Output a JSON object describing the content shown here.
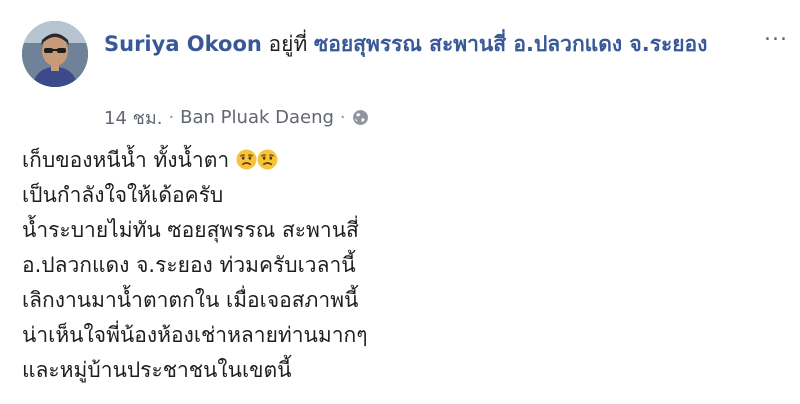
{
  "post": {
    "author": "Suriya Okoon",
    "location_prefix": " อยู่ที่ ",
    "location": "ซอยสุพรรณ สะพานสี่ อ.ปลวกแดง จ.ระยอง",
    "time": "14 ชม.",
    "separator": "·",
    "place": "Ban Pluak Daeng",
    "privacy_icon": "globe-icon",
    "more_label": "...",
    "lines": [
      "เก็บของหนีน้ำ ทั้งน้ำตา",
      "เป็นกำลังใจให้เด้อครับ",
      "น้ำระบายไม่ทัน ซอยสุพรรณ สะพานสี่",
      "อ.ปลวกแดง จ.ระยอง ท่วมครับเวลานี้",
      "เลิกงานมาน้ำตาตกใน เมื่อเจอสภาพนี้",
      "น่าเห็นใจพี่น้องห้องเช่าหลายท่านมากๆ",
      "และหมู่บ้านประชาชนในเขตนี้"
    ],
    "emoji_icons": [
      "sad-face-icon",
      "sad-face-icon"
    ]
  },
  "colors": {
    "link": "#385898",
    "text": "#1c1e21",
    "meta": "#616770"
  }
}
